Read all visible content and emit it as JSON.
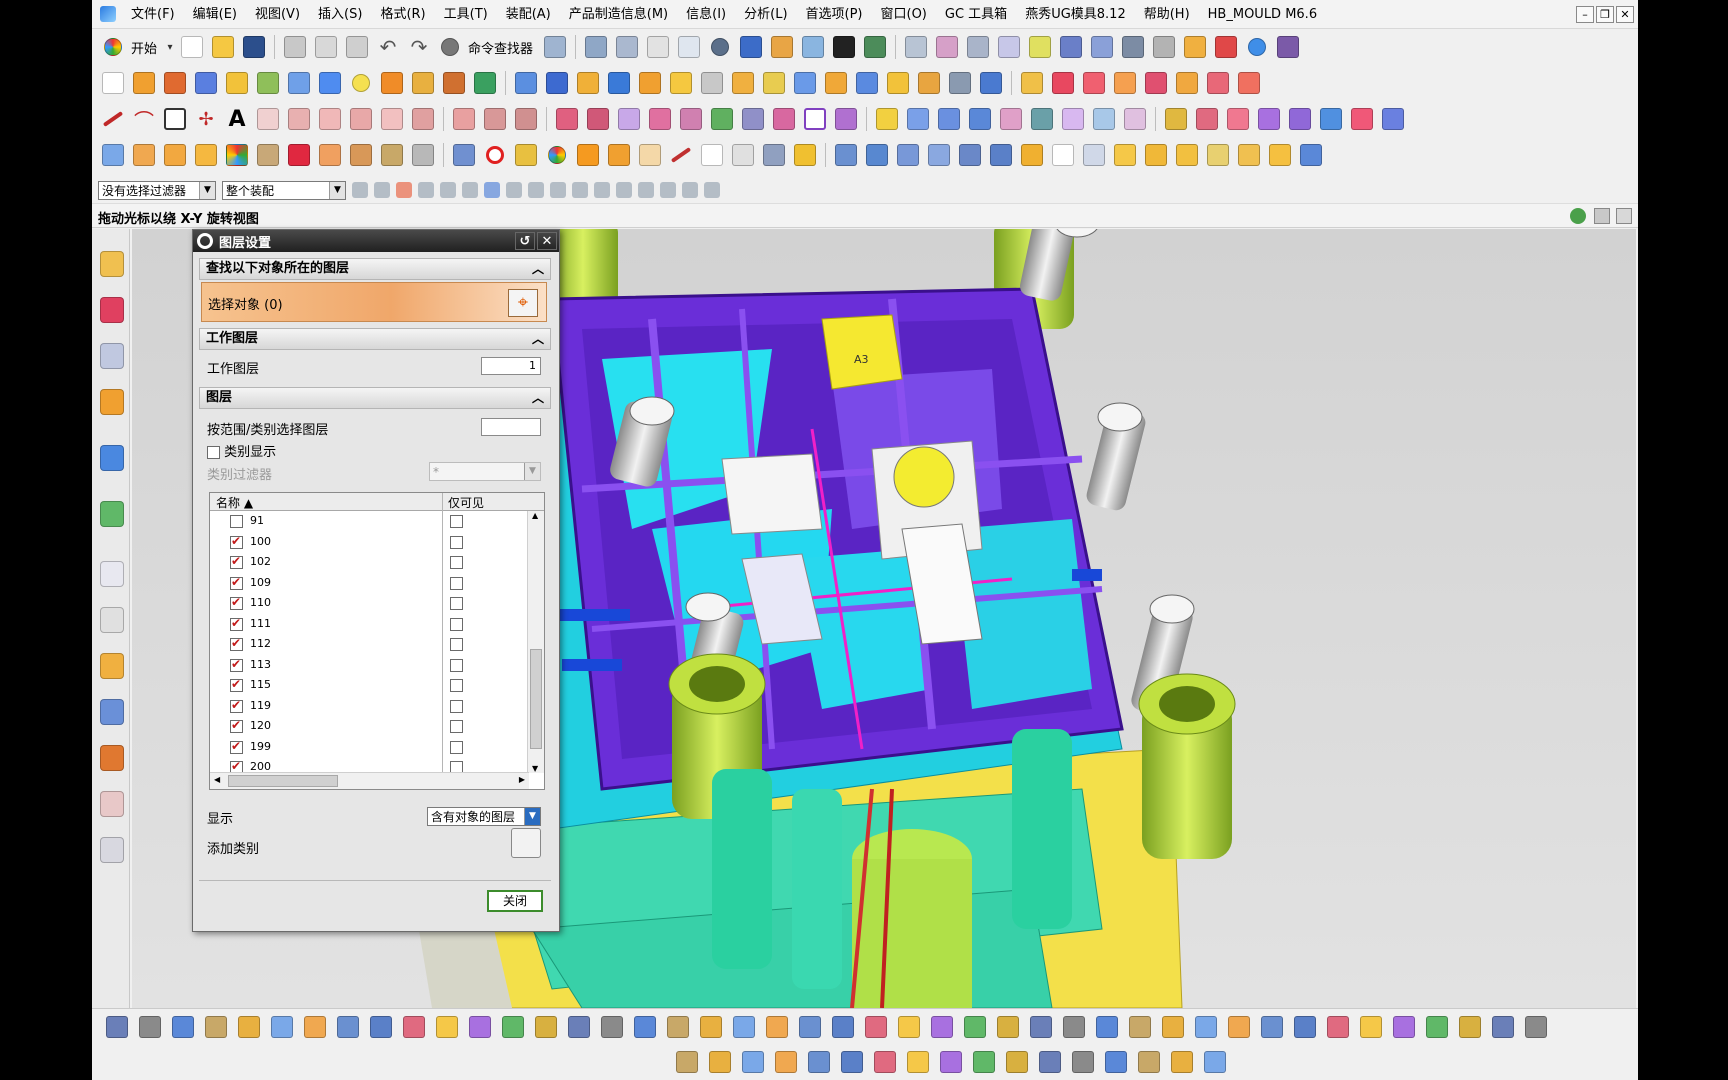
{
  "menubar": {
    "items": [
      "文件(F)",
      "编辑(E)",
      "视图(V)",
      "插入(S)",
      "格式(R)",
      "工具(T)",
      "装配(A)",
      "产品制造信息(M)",
      "信息(I)",
      "分析(L)",
      "首选项(P)",
      "窗口(O)",
      "GC 工具箱",
      "燕秀UG模具8.12",
      "帮助(H)",
      "HB_MOULD M6.6"
    ]
  },
  "toolbar": {
    "start_label": "开始",
    "command_finder_label": "命令查找器"
  },
  "filters": {
    "selection_filter": "没有选择过滤器",
    "assembly_scope": "整个装配"
  },
  "status": {
    "text": "拖动光标以绕 X-Y 旋转视图"
  },
  "dialog": {
    "title": "图层设置",
    "find_section": "查找以下对象所在的图层",
    "select_objects": "选择对象 (0)",
    "work_layer_section": "工作图层",
    "work_layer_label": "工作图层",
    "work_layer_value": "1",
    "layers_section": "图层",
    "select_by_range_label": "按范围/类别选择图层",
    "category_display_label": "类别显示",
    "category_filter_label": "类别过滤器",
    "category_filter_value": "*",
    "columns": {
      "name": "名称",
      "visible_only": "仅可见"
    },
    "rows": [
      {
        "layer": "91",
        "on": false
      },
      {
        "layer": "100",
        "on": true
      },
      {
        "layer": "102",
        "on": true
      },
      {
        "layer": "109",
        "on": true
      },
      {
        "layer": "110",
        "on": true
      },
      {
        "layer": "111",
        "on": true
      },
      {
        "layer": "112",
        "on": true
      },
      {
        "layer": "113",
        "on": true
      },
      {
        "layer": "115",
        "on": true
      },
      {
        "layer": "119",
        "on": true
      },
      {
        "layer": "120",
        "on": true
      },
      {
        "layer": "199",
        "on": true
      },
      {
        "layer": "200",
        "on": true
      }
    ],
    "display_label": "显示",
    "display_value": "含有对象的图层",
    "add_category_label": "添加类别",
    "close_label": "关闭"
  },
  "model": {
    "tag_label": "A3"
  },
  "colors": {
    "accent": "#f0a76a",
    "mold_purple": "#6a2ed8",
    "cyan": "#22d0e8",
    "green": "#b8e04a",
    "teal": "#36d2a8"
  }
}
